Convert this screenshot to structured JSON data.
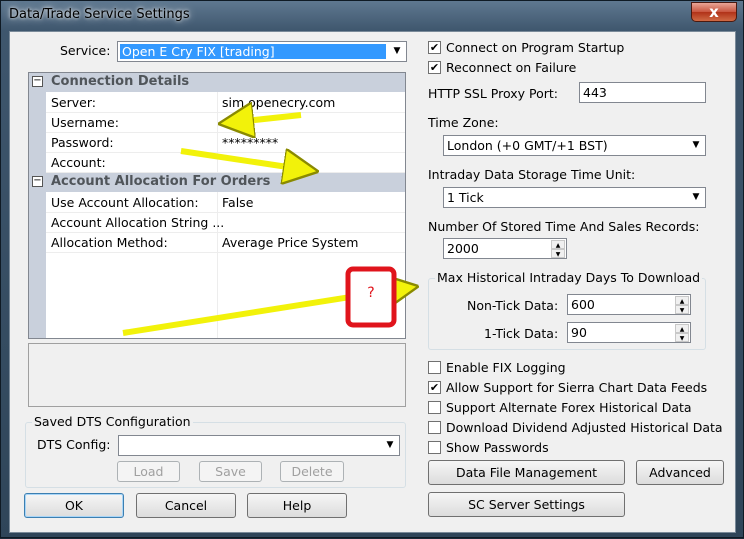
{
  "window": {
    "title": "Data/Trade Service Settings",
    "close_glyph": "x"
  },
  "service": {
    "label": "Service:",
    "value": "Open E Cry FIX   [trading]"
  },
  "grid": {
    "sections": [
      {
        "title": "Connection Details",
        "rows": [
          {
            "key": "Server:",
            "value": "sim.openecry.com"
          },
          {
            "key": "Username:",
            "value": ""
          },
          {
            "key": "Password:",
            "value": "*********"
          },
          {
            "key": "Account:",
            "value": ""
          }
        ]
      },
      {
        "title": "Account Allocation For Orders",
        "rows": [
          {
            "key": "Use Account Allocation:",
            "value": "False"
          },
          {
            "key": "Account Allocation String ...",
            "value": ""
          },
          {
            "key": "Allocation Method:",
            "value": "Average Price System"
          }
        ]
      }
    ],
    "collapse_glyph": "−"
  },
  "saved_dts": {
    "group_title": "Saved DTS Configuration",
    "config_label": "DTS Config:",
    "config_value": "",
    "load": "Load",
    "save": "Save",
    "delete": "Delete"
  },
  "buttons": {
    "ok": "OK",
    "cancel": "Cancel",
    "help": "Help",
    "data_file_mgmt": "Data File Management",
    "advanced": "Advanced",
    "sc_server": "SC Server Settings"
  },
  "right": {
    "connect_startup": {
      "label": "Connect on Program Startup",
      "checked": true
    },
    "reconnect": {
      "label": "Reconnect on Failure",
      "checked": true
    },
    "proxy_label": "HTTP SSL Proxy Port:",
    "proxy_value": "443",
    "tz_label": "Time Zone:",
    "tz_value": "London (+0 GMT/+1 BST)",
    "intraday_label": "Intraday Data Storage Time Unit:",
    "intraday_value": "1 Tick",
    "stored_label": "Number Of Stored Time And Sales Records:",
    "stored_value": "2000",
    "maxhist_title": "Max Historical Intraday Days To Download",
    "nontick_label": "Non-Tick Data:",
    "nontick_value": "600",
    "onetick_label": "1-Tick Data:",
    "onetick_value": "90",
    "checks": [
      {
        "label": "Enable FIX Logging",
        "checked": false
      },
      {
        "label": "Allow Support for Sierra Chart Data Feeds",
        "checked": true
      },
      {
        "label": "Support Alternate Forex Historical Data",
        "checked": false
      },
      {
        "label": "Download Dividend Adjusted Historical Data",
        "checked": false
      },
      {
        "label": "Show Passwords",
        "checked": false
      }
    ]
  },
  "annotation": {
    "callout_text": "?",
    "arrow_color": "#f2f20a",
    "callout_color": "#e0141c"
  }
}
